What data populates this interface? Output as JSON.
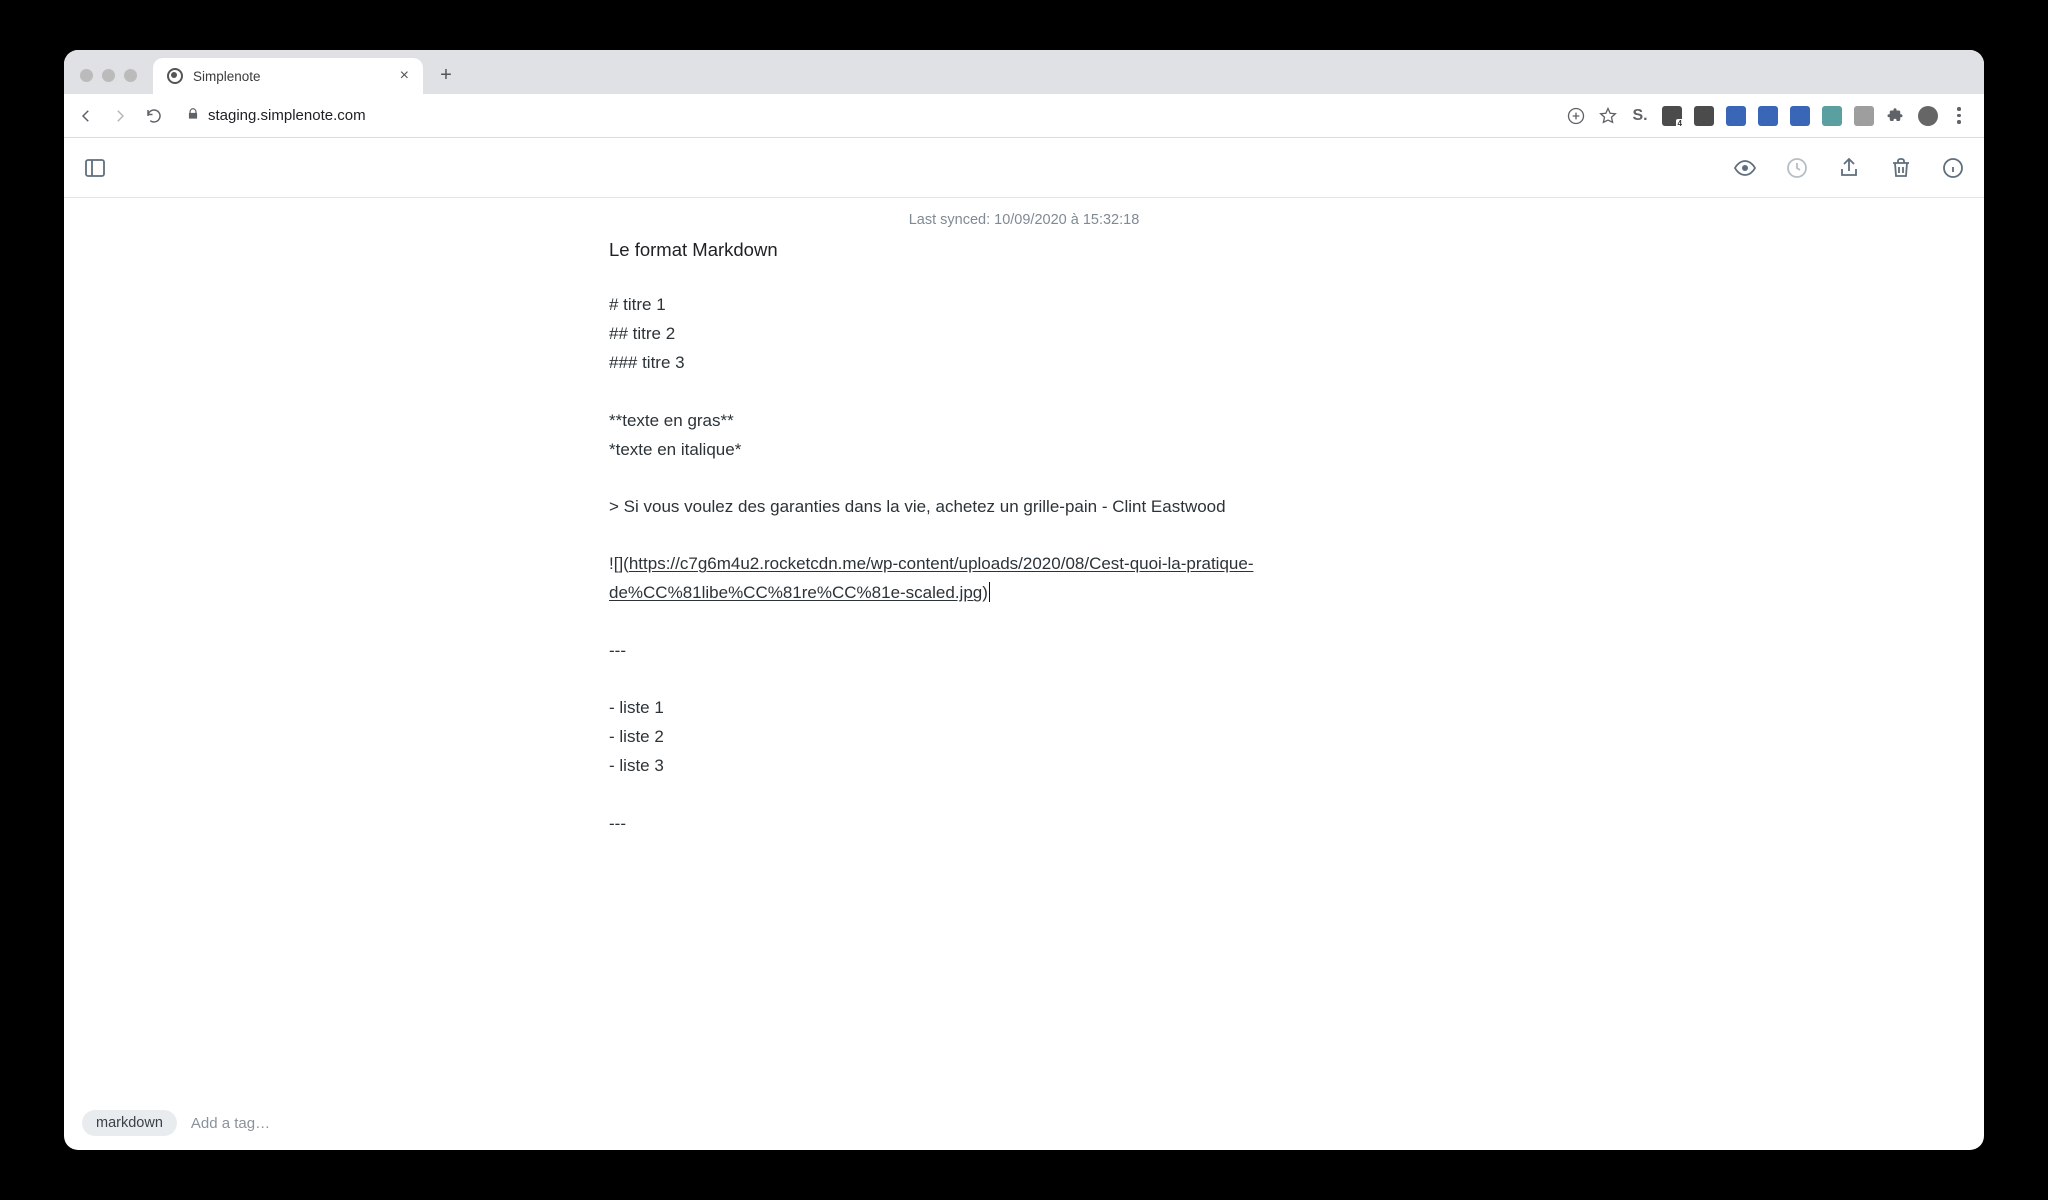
{
  "browser": {
    "tab_title": "Simplenote",
    "url": "staging.simplenote.com"
  },
  "toolbar": {
    "sidebar_toggle": "Toggle sidebar",
    "preview": "Preview",
    "history": "History",
    "share": "Share",
    "trash": "Trash",
    "info": "Info"
  },
  "sync_status": "Last synced: 10/09/2020 à 15:32:18",
  "note": {
    "title": "Le format Markdown",
    "lines": {
      "h1": "# titre 1",
      "h2": "## titre 2",
      "h3": "### titre 3",
      "bold": "**texte en gras**",
      "italic": "*texte en italique*",
      "quote": "> Si vous voulez des garanties dans la vie, achetez un grille-pain - Clint Eastwood",
      "img_prefix": "![](",
      "img_url": "https://c7g6m4u2.rocketcdn.me/wp-content/uploads/2020/08/Cest-quoi-la-pratique-de%CC%81libe%CC%81re%CC%81e-scaled.jpg",
      "img_suffix": ")",
      "hr1": "---",
      "li1": "- liste 1",
      "li2": "- liste 2",
      "li3": "- liste 3",
      "hr2": "---"
    }
  },
  "tags": {
    "items": [
      "markdown"
    ],
    "placeholder": "Add a tag…"
  }
}
